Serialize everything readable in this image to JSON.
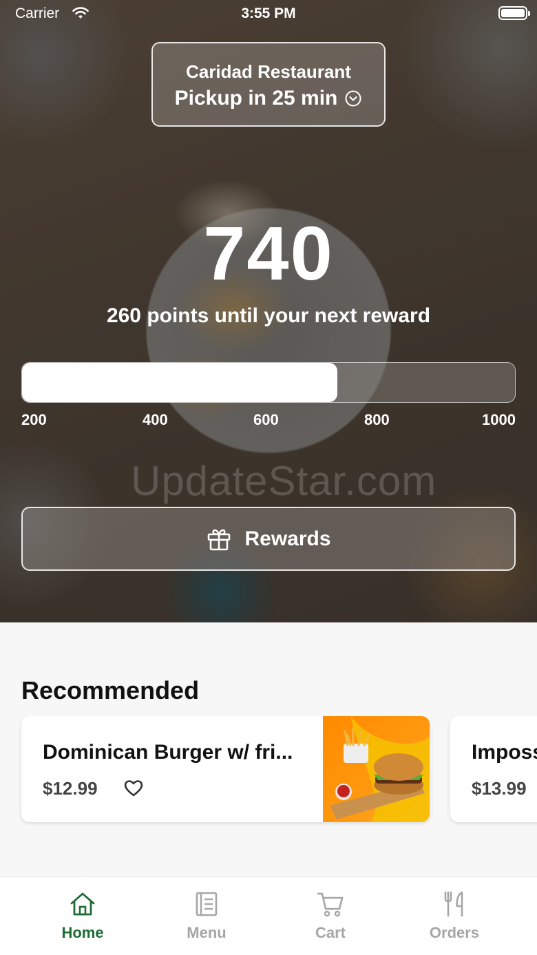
{
  "status_bar": {
    "carrier": "Carrier",
    "time": "3:55 PM"
  },
  "location": {
    "name": "Caridad Restaurant",
    "pickup": "Pickup in 25 min"
  },
  "rewards": {
    "points": "740",
    "caption": "260 points until your next reward",
    "progress_fraction": 0.64,
    "ticks": [
      "200",
      "400",
      "600",
      "800",
      "1000"
    ],
    "button_label": "Rewards"
  },
  "watermark": "UpdateStar.com",
  "recommended": {
    "title": "Recommended",
    "items": [
      {
        "name": "Dominican Burger w/ fri...",
        "price": "$12.99"
      },
      {
        "name": "Imposs",
        "price": "$13.99"
      }
    ]
  },
  "tabs": [
    {
      "label": "Home",
      "active": true
    },
    {
      "label": "Menu",
      "active": false
    },
    {
      "label": "Cart",
      "active": false
    },
    {
      "label": "Orders",
      "active": false
    }
  ],
  "colors": {
    "accent": "#1e6b35",
    "tab_inactive": "#a6a6a6",
    "card_image_bg": "#ff8a00"
  }
}
